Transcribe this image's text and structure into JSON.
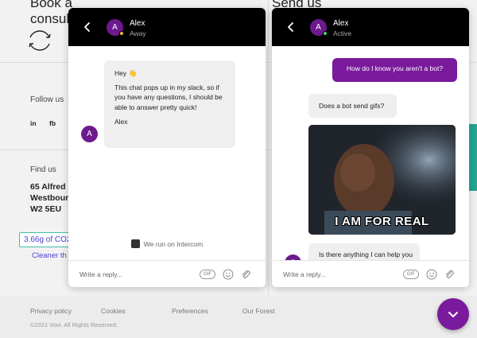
{
  "background": {
    "heading_left": "Book a",
    "heading_left_2": "consult",
    "heading_right": "Send us",
    "follow_us": "Follow us",
    "social": [
      "in",
      "fb"
    ],
    "find_us": "Find us",
    "address": [
      "65 Alfred",
      "Westbour",
      "W2 5EU"
    ],
    "co2_badge": "3.66g of CO2",
    "cleaner_link": "Cleaner th",
    "footer_links": [
      "Privacy policy",
      "Cookies",
      "Preferences",
      "Our Forest"
    ],
    "copyright": "©2021 Vovi. All Rights Reserved."
  },
  "left_chat": {
    "agent_name": "Alex",
    "agent_initial": "A",
    "agent_status": "Away",
    "message": {
      "greeting": "Hey 👋",
      "body": "This chat pops up in my slack, so if you have any questions, I should be able to answer pretty quick!",
      "signature": "Alex"
    },
    "powered_by": "We run on Intercom",
    "composer_placeholder": "Write a reply...",
    "gif_label": "GIF"
  },
  "right_chat": {
    "agent_name": "Alex",
    "agent_initial": "A",
    "agent_status": "Active",
    "user_message": "How do I know you aren't a bot?",
    "agent_reply_1": "Does a bot send gifs?",
    "gif_caption": "I AM FOR REAL",
    "agent_reply_2": "Is there anything I can help you",
    "composer_placeholder": "Write a reply...",
    "gif_label": "GIF"
  },
  "colors": {
    "accent_purple": "#7a1a9c",
    "away_dot": "#e8b93a",
    "active_dot": "#3ed36b",
    "header_bg": "#000000"
  },
  "icons": {
    "back": "chevron-left-icon",
    "emoji": "smiley-icon",
    "attach": "paperclip-icon",
    "launcher": "chevron-down-icon"
  }
}
